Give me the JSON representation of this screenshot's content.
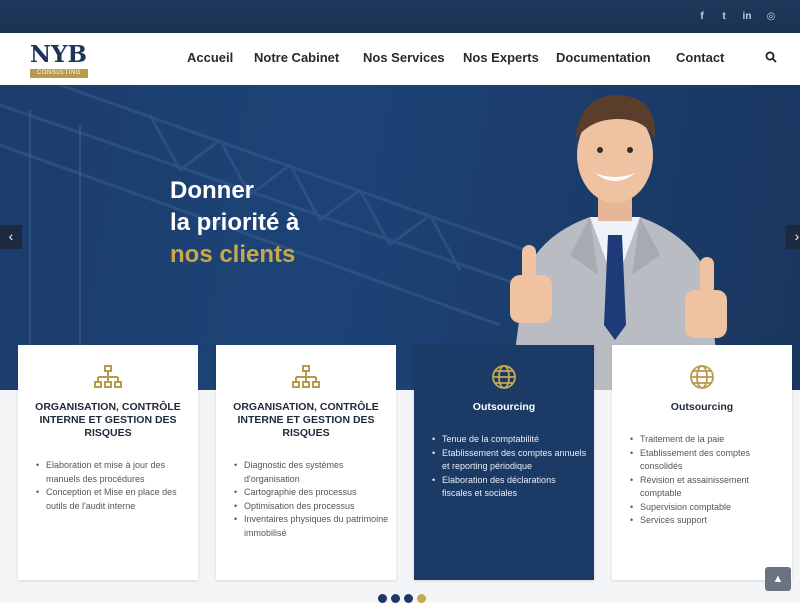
{
  "social": [
    {
      "name": "facebook-icon",
      "glyph": "f"
    },
    {
      "name": "twitter-icon",
      "glyph": "t"
    },
    {
      "name": "linkedin-icon",
      "glyph": "in"
    },
    {
      "name": "instagram-icon",
      "glyph": "◎"
    }
  ],
  "brand": {
    "name": "NYB",
    "sub": "CONSULTING",
    "accent": "#b89a4b",
    "navy": "#1d3557"
  },
  "nav": [
    {
      "label": "Accueil"
    },
    {
      "label": "Notre Cabinet"
    },
    {
      "label": "Nos Services"
    },
    {
      "label": "Nos Experts"
    },
    {
      "label": "Documentation"
    },
    {
      "label": "Contact"
    }
  ],
  "hero": {
    "line1": "Donner",
    "line2": "la priorité à",
    "line3": "nos clients"
  },
  "cards": [
    {
      "title": "ORGANISATION, CONTRÔLE INTERNE ET GESTION DES RISQUES",
      "items": [
        "Elaboration et mise à jour des manuels des procédures",
        "Conception et Mise en place des outils de l'audit interne"
      ]
    },
    {
      "title": "ORGANISATION, CONTRÔLE INTERNE ET GESTION DES RISQUES",
      "items": [
        "Diagnostic des systèmes d'organisation",
        "Cartographie des processus",
        "Optimisation des processus",
        "Inventaires physiques du patrimoine immobilisé"
      ]
    },
    {
      "title": "Outsourcing",
      "items": [
        "Tenue de la comptabilité",
        "Etablissement des comptes annuels et reporting périodique",
        "Elaboration des déclarations fiscales et sociales"
      ]
    },
    {
      "title": "Outsourcing",
      "items": [
        "Traitement de la paie",
        "Etablissement des comptes consolidés",
        "Révision et assainissement comptable",
        "Supervision comptable",
        "Services support"
      ]
    }
  ]
}
